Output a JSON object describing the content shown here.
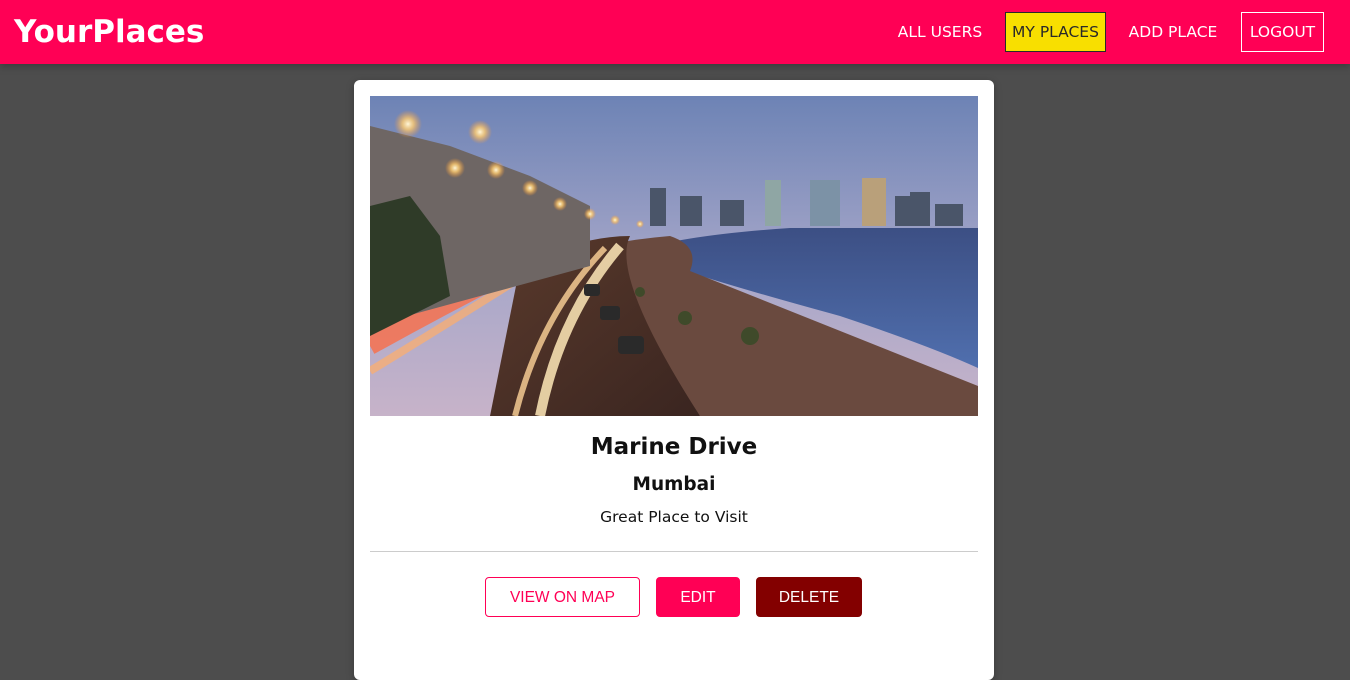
{
  "header": {
    "logo": "YourPlaces",
    "nav": {
      "all_users": "ALL USERS",
      "my_places": "MY PLACES",
      "add_place": "ADD PLACE",
      "logout": "LOGOUT"
    }
  },
  "place": {
    "title": "Marine Drive",
    "city": "Mumbai",
    "description": "Great Place to Visit",
    "image_alt": "Marine Drive",
    "actions": {
      "view_on_map": "VIEW ON MAP",
      "edit": "EDIT",
      "delete": "DELETE"
    }
  },
  "colors": {
    "brand": "#ff0055",
    "active_nav": "#f8df00",
    "danger": "#830000",
    "backdrop": "#4d4d4d"
  }
}
